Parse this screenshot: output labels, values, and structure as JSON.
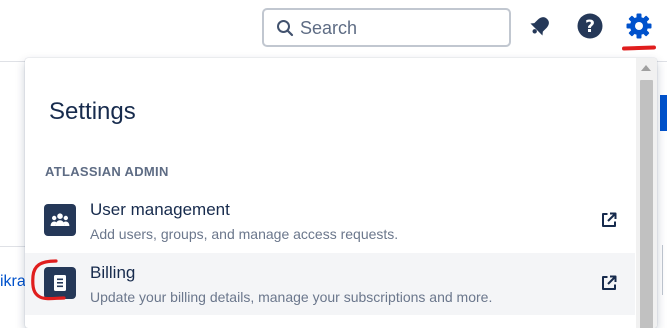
{
  "search": {
    "placeholder": "Search"
  },
  "topbar": {
    "icons": [
      "notifications-icon",
      "help-icon",
      "settings-gear-icon"
    ]
  },
  "background": {
    "left_fragment": "ikra"
  },
  "panel": {
    "title": "Settings",
    "section_heading": "ATLASSIAN ADMIN",
    "items": [
      {
        "title": "User management",
        "description": "Add users, groups, and manage access requests.",
        "icon": "users-icon"
      },
      {
        "title": "Billing",
        "description": "Update your billing details, manage your subscriptions and more.",
        "icon": "billing-icon"
      }
    ]
  },
  "colors": {
    "accent": "#0052cc",
    "annotation": "#e01e1e",
    "tile": "#253858",
    "text": "#172b4d",
    "subtext": "#6b778c"
  }
}
